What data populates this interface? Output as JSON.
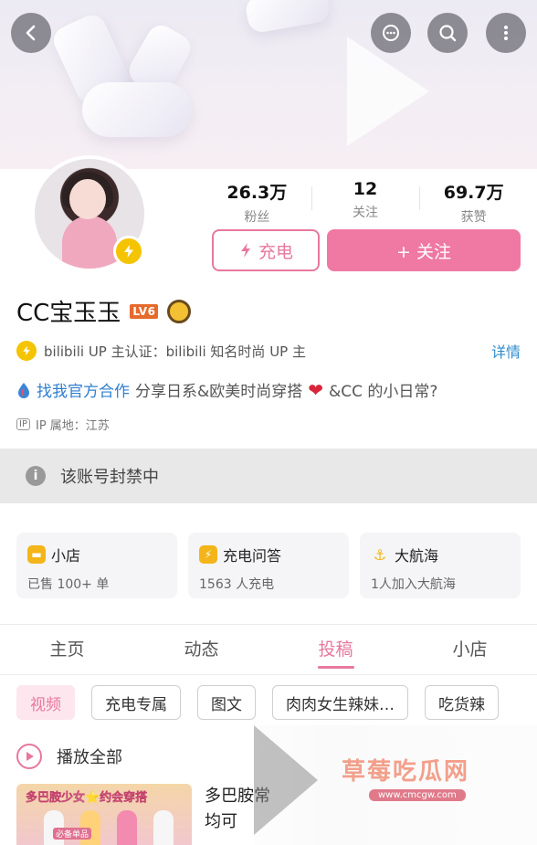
{
  "header": {
    "back_icon": "back-icon",
    "message_icon": "message-icon",
    "search_icon": "search-icon",
    "more_icon": "more-icon"
  },
  "profile": {
    "name": "CC宝玉玉",
    "level": "LV6",
    "stats": [
      {
        "value": "26.3万",
        "label": "粉丝"
      },
      {
        "value": "12",
        "label": "关注"
      },
      {
        "value": "69.7万",
        "label": "获赞"
      }
    ],
    "charge_label": "充电",
    "follow_label": "+ 关注",
    "verification": "bilibili UP 主认证：bilibili 知名时尚 UP 主",
    "detail_link": "详情",
    "cooperation_link": "找我官方合作",
    "bio": "分享日系&欧美时尚穿搭",
    "bio_tail": "&CC 的小日常?",
    "ip_tag": "IP",
    "ip_location": "IP 属地：江苏"
  },
  "notice": {
    "text": "该账号封禁中"
  },
  "cards": [
    {
      "title": "小店",
      "subtitle": "已售 100+ 单",
      "icon": "shop-icon"
    },
    {
      "title": "充电问答",
      "subtitle": "1563 人充电",
      "icon": "charge-qa-icon"
    },
    {
      "title": "大航海",
      "subtitle": "1人加入大航海",
      "icon": "voyage-icon"
    }
  ],
  "tabs": [
    {
      "label": "主页",
      "active": false
    },
    {
      "label": "动态",
      "active": false
    },
    {
      "label": "投稿",
      "active": true
    },
    {
      "label": "小店",
      "active": false
    }
  ],
  "filter_chips": [
    {
      "label": "视频",
      "active": true
    },
    {
      "label": "充电专属",
      "active": false
    },
    {
      "label": "图文",
      "active": false
    },
    {
      "label": "肉肉女生辣妹…",
      "active": false
    },
    {
      "label": "吃货辣",
      "active": false
    }
  ],
  "play_all_label": "播放全部",
  "videos": [
    {
      "thumbnail_text": "多巴胺少女⭐约会穿搭",
      "thumbnail_tag": "必备单品",
      "title": "多巴胺常均可"
    }
  ],
  "watermark": {
    "title": "草莓吃瓜网",
    "url": "www.cmcgw.com"
  },
  "colors": {
    "accent_pink": "#ef79a3",
    "link_blue": "#2f8ccf",
    "badge_yellow": "#f5c400",
    "banned_bar": "#e8e8e8"
  }
}
